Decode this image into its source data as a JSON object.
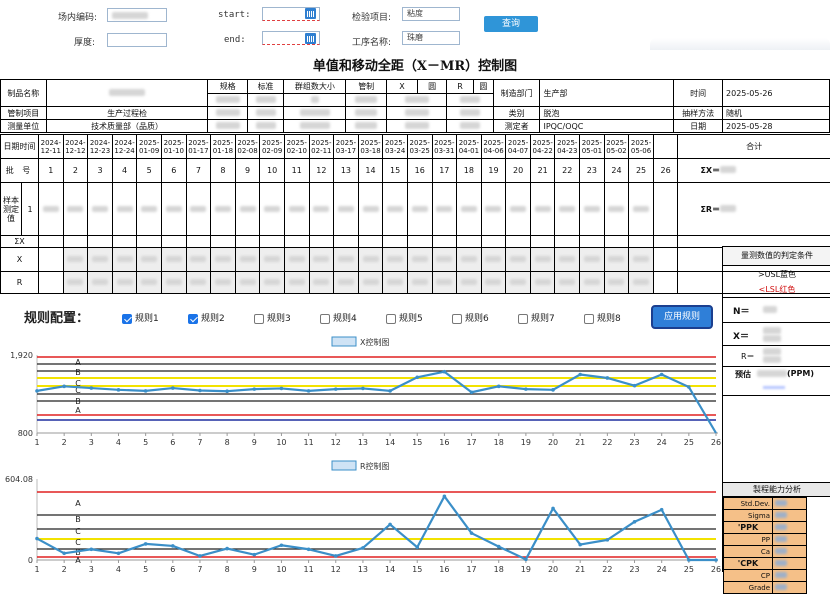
{
  "filters": {
    "site_code_label": "场内编码:",
    "start_label": "start:",
    "item_label": "检验项目:",
    "item_value": "粘度",
    "thickness_label": "厚度:",
    "end_label": "end:",
    "process_label": "工序名称:",
    "process_value": "珠磨",
    "query_label": "查询"
  },
  "title": "单值和移动全距（X－MR）控制图",
  "header": {
    "product_label": "制品名称",
    "spec_label": "规格",
    "standard_label": "标准",
    "group_size_label": "群组数大小",
    "control_label": "管制",
    "x_label": "X",
    "r_label": "R",
    "circle_label": "圆",
    "mfg_dept_label": "制造部门",
    "mfg_dept_value": "生产部",
    "time_label": "时间",
    "time_value": "2025-05-26",
    "control_item_label": "管制项目",
    "control_item_value": "生产过程检",
    "category_label": "类别",
    "category_value": "脱泡",
    "sampling_label": "抽样方法",
    "sampling_value": "随机",
    "unit_label": "测量单位",
    "unit_value": "技术质量部（品质）",
    "measurer_label": "测定者",
    "measurer_value": "IPQC/OQC",
    "date_label": "日期",
    "date_value": "2025-05-28",
    "datetime_label": "日期时间",
    "total_label": "合计",
    "batch_label": "批 号",
    "sum_x_label": "ΣX＝",
    "sum_r_label": "ΣR＝",
    "sample_label": "样本测定值",
    "sample_row": "1",
    "sigma_x_row": "ΣX",
    "x_row": "X",
    "r_row": "R"
  },
  "dates": [
    "2024-12-11",
    "2024-12-12",
    "2024-12-23",
    "2024-12-24",
    "2025-01-09",
    "2025-01-10",
    "2025-01-17",
    "2025-01-18",
    "2025-02-08",
    "2025-02-09",
    "2025-02-10",
    "2025-02-11",
    "2025-03-17",
    "2025-03-18",
    "2025-03-24",
    "2025-03-25",
    "2025-03-31",
    "2025-04-01",
    "2025-04-06",
    "2025-04-07",
    "2025-04-22",
    "2025-04-23",
    "2025-05-01",
    "2025-05-02",
    "2025-05-06",
    ""
  ],
  "batch_numbers": [
    "1",
    "2",
    "3",
    "4",
    "5",
    "6",
    "7",
    "8",
    "9",
    "10",
    "11",
    "12",
    "13",
    "14",
    "15",
    "16",
    "17",
    "18",
    "19",
    "20",
    "21",
    "22",
    "23",
    "24",
    "25",
    "26"
  ],
  "rules": {
    "label": "规则配置：",
    "items": [
      {
        "label": "规则1",
        "checked": true
      },
      {
        "label": "规则2",
        "checked": true
      },
      {
        "label": "规则3",
        "checked": false
      },
      {
        "label": "规则4",
        "checked": false
      },
      {
        "label": "规则5",
        "checked": false
      },
      {
        "label": "规则6",
        "checked": false
      },
      {
        "label": "规则7",
        "checked": false
      },
      {
        "label": "规则8",
        "checked": false
      }
    ],
    "apply_label": "应用规则"
  },
  "side": {
    "judge_title": "量测数值的判定条件",
    "usl_text": ">USL蓝色",
    "lsl_text": "<LSL红色",
    "n_label": "N＝",
    "x_label": "X＝",
    "r_label": "R＝",
    "forecast_label": "预估",
    "ppm_label": "(PPM)",
    "capability_title": "製程能力分析",
    "cap_rows": [
      "Std.Dev.",
      "Sigma",
      "'PPK",
      "PP",
      "Ca",
      "'CPK",
      "CP",
      "Grade"
    ]
  },
  "colors": {
    "ucl": "#e02020",
    "lcl": "#1f2f9f",
    "center": "#f2e200",
    "zone": "#222222",
    "series": "#3b8fc8",
    "side_orange": "#f5c088"
  },
  "chart_data": [
    {
      "type": "line",
      "title": "X控制图",
      "series": [
        {
          "name": "X控制图",
          "values": [
            1405,
            1470,
            1445,
            1420,
            1405,
            1445,
            1410,
            1400,
            1430,
            1440,
            1405,
            1430,
            1440,
            1405,
            1600,
            1680,
            1385,
            1470,
            1430,
            1420,
            1640,
            1590,
            1480,
            1640,
            1460,
            800
          ]
        }
      ],
      "x": [
        1,
        2,
        3,
        4,
        5,
        6,
        7,
        8,
        9,
        10,
        11,
        12,
        13,
        14,
        15,
        16,
        17,
        18,
        19,
        20,
        21,
        22,
        23,
        24,
        25,
        26
      ],
      "ylim": [
        800,
        1920
      ],
      "y_ticks_shown": [
        800,
        1920
      ],
      "control_lines": {
        "UCL": 1680,
        "LCL": 1150,
        "CL": 1460
      },
      "zones": [
        "A",
        "B",
        "C",
        "C",
        "B",
        "A"
      ]
    },
    {
      "type": "line",
      "title": "R控制图",
      "series": [
        {
          "name": "R控制图",
          "values": [
            160,
            50,
            80,
            50,
            120,
            105,
            30,
            85,
            40,
            110,
            80,
            30,
            90,
            265,
            95,
            475,
            200,
            100,
            5,
            385,
            115,
            150,
            285,
            375,
            0,
            0
          ]
        }
      ],
      "x": [
        1,
        2,
        3,
        4,
        5,
        6,
        7,
        8,
        9,
        10,
        11,
        12,
        13,
        14,
        15,
        16,
        17,
        18,
        19,
        20,
        21,
        22,
        23,
        24,
        25,
        26
      ],
      "ylim": [
        0,
        604.08
      ],
      "y_ticks_shown": [
        0,
        604.08
      ],
      "zones": [
        "A",
        "B",
        "C",
        "C",
        "B",
        "A"
      ]
    }
  ]
}
